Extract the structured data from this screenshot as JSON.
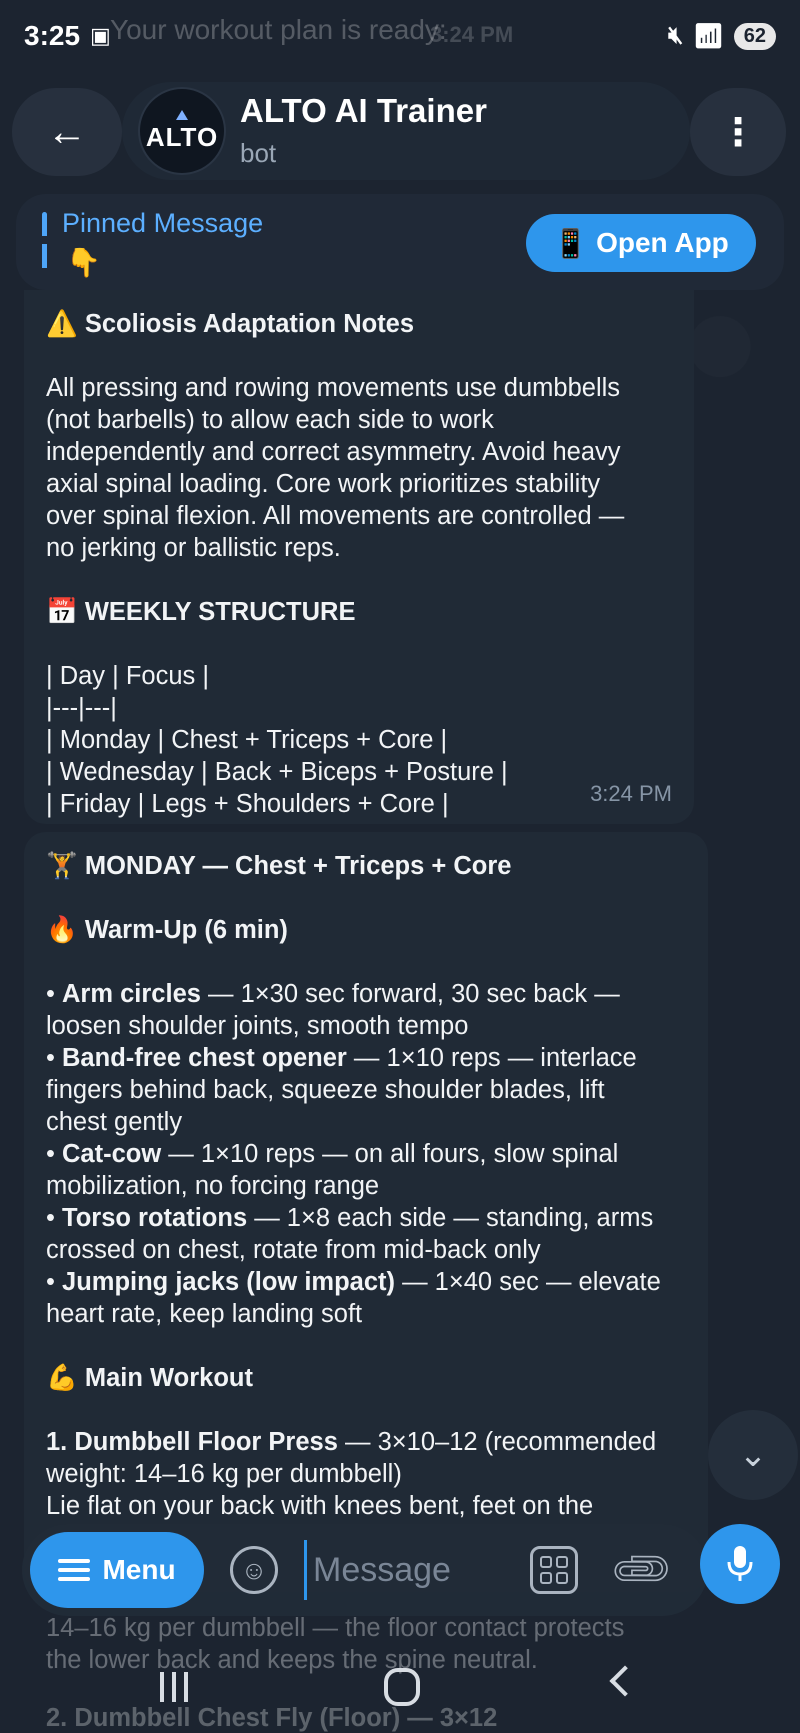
{
  "status_bar": {
    "time": "3:25",
    "battery": "62",
    "ghost_notification": "Your workout plan is ready:",
    "ghost_time": "3:24 PM"
  },
  "header": {
    "title": "ALTO AI Trainer",
    "subtitle": "bot",
    "avatar_text": "ALTO"
  },
  "pinned": {
    "label": "Pinned Message",
    "emoji": "👇",
    "open_app_label": "Open App",
    "open_app_emoji": "📱"
  },
  "message1": {
    "heading_emoji": "⚠️",
    "heading": "Scoliosis Adaptation Notes",
    "body_lines": [
      "All pressing and rowing movements use dumbbells",
      "(not barbells) to allow each side to work",
      "independently and correct asymmetry. Avoid heavy",
      "axial spinal loading. Core work prioritizes stability",
      "over spinal flexion. All movements are controlled —",
      "no jerking or ballistic reps."
    ],
    "weekly_emoji": "📅",
    "weekly_heading": "WEEKLY STRUCTURE",
    "table_lines": [
      "| Day | Focus |",
      "|---|---|",
      "| Monday | Chest + Triceps + Core |",
      "| Wednesday | Back + Biceps + Posture |",
      "| Friday | Legs + Shoulders + Core |"
    ],
    "time": "3:24 PM"
  },
  "message2": {
    "heading_emoji": "🏋",
    "heading": "MONDAY — Chest + Triceps + Core",
    "warmup_emoji": "🔥",
    "warmup_heading": "Warm-Up (6 min)",
    "warmup_items": [
      {
        "name": "Arm circles",
        "rest_lines": [
          " — 1×30 sec forward, 30 sec back —",
          "loosen shoulder joints, smooth tempo"
        ]
      },
      {
        "name": "Band-free chest opener",
        "rest_lines": [
          " — 1×10 reps — interlace",
          "fingers behind back, squeeze shoulder blades, lift",
          "chest gently"
        ]
      },
      {
        "name": "Cat-cow",
        "rest_lines": [
          " — 1×10 reps — on all fours, slow spinal",
          "mobilization, no forcing range"
        ]
      },
      {
        "name": "Torso rotations",
        "rest_lines": [
          " — 1×8 each side — standing, arms",
          "crossed on chest, rotate from mid-back only"
        ]
      },
      {
        "name": "Jumping jacks (low impact)",
        "rest_lines": [
          " — 1×40 sec — elevate",
          "heart rate, keep landing soft"
        ]
      }
    ],
    "main_emoji": "💪",
    "main_heading": "Main Workout",
    "exercise1_name": "1. Dumbbell Floor Press",
    "exercise1_rest": " — 3×10–12 (recommended",
    "exercise1_line2": "weight: 14–16 kg per dumbbell)",
    "exercise1_line3": "Lie flat on your back with knees bent, feet on the"
  },
  "faded": {
    "line1": "14–16 kg per dumbbell — the floor contact protects",
    "line2": "the lower back and keeps the spine neutral.",
    "line3": "2. Dumbbell Chest Fly (Floor) — 3×12"
  },
  "composer": {
    "menu_label": "Menu",
    "placeholder": "Message"
  }
}
